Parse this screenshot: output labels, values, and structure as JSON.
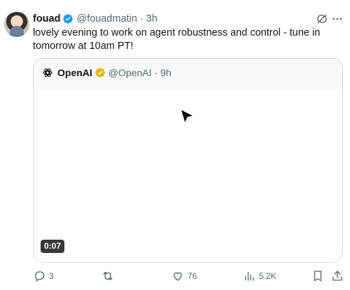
{
  "author": {
    "name": "fouad",
    "handle": "@fouadmatin",
    "age": "3h",
    "text": "lovely evening to work on agent robustness and control - tune in tomorrow at 10am PT!"
  },
  "quoted": {
    "name": "OpenAI",
    "handle": "@OpenAI",
    "age": "9h",
    "video_duration": "0:07"
  },
  "metrics": {
    "replies": "3",
    "retweets": "",
    "likes": "76",
    "views": "5.2K"
  },
  "colors": {
    "verified_blue": "#1d9bf0",
    "verified_gold": "#e2b719",
    "muted_text": "#536471",
    "border": "#cfd9de"
  }
}
